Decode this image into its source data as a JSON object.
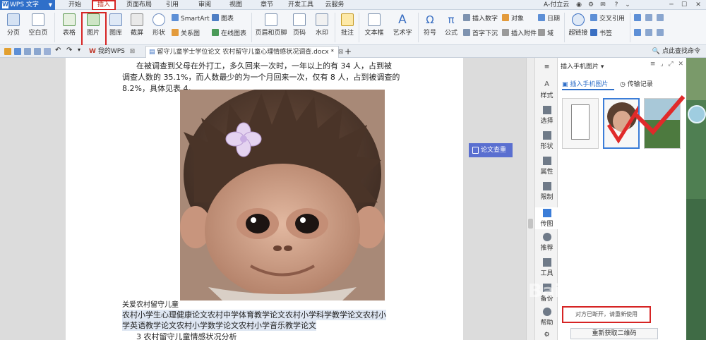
{
  "menubar": {
    "app_name": "WPS 文字",
    "tabs": [
      "开始",
      "插入",
      "页面布局",
      "引用",
      "审阅",
      "视图",
      "章节",
      "开发工具",
      "云服务"
    ],
    "user": "A-付立云"
  },
  "ribbon": {
    "page_break": "分页",
    "blank_page": "空白页",
    "table": "表格",
    "picture": "图片",
    "gallery": "图库",
    "screenshot": "截屏",
    "shapes": "形状",
    "smartart": "SmartArt",
    "chart": "图表",
    "relation": "关系图",
    "online_chart": "在线图表",
    "header_footer": "页眉和页脚",
    "page_number": "页码",
    "watermark": "水印",
    "comment": "批注",
    "textbox": "文本框",
    "wordart": "艺术字",
    "symbol": "符号",
    "formula": "公式",
    "insert_number": "插入数字",
    "object": "对象",
    "drop_cap": "首字下沉",
    "attachment": "插入附件",
    "date": "日期",
    "field": "域",
    "hyperlink": "超链接",
    "cross_ref": "交叉引用",
    "bookmark": "书签"
  },
  "doctabs": {
    "home": "我的WPS",
    "doc": "留守儿童学士学位论文 农村留守儿童心理情感状况调查.docx *",
    "add": "+",
    "help": "点此查找命令"
  },
  "document": {
    "line1": "在被调查到父母在外打工，多久回来一次时，一年以上的有 34 人，占到被",
    "line2": "调查人数的 35.1%，而人数最少的为一个月回来一次，仅有 8 人，占到被调查的",
    "line3": "8.2%，具体见表 4。",
    "caption": "关爱农村留守儿童",
    "link1": "农村小学生心理健康论文农村中学体育教学论文农村小学科学教学论文农村小",
    "link2": "学英语教学论文农村小学数学论文农村小学音乐教学论文",
    "heading": "3 农村留守儿童情感状况分析"
  },
  "float_button": "论文查重",
  "rail": [
    "样式",
    "选择",
    "形状",
    "属性",
    "限制",
    "传图",
    "推荐",
    "工具",
    "备份",
    "帮助"
  ],
  "panel": {
    "title": "插入手机图片",
    "tab_phone": "插入手机图片",
    "tab_history": "传输记录",
    "status": "对方已断开，请重新使用",
    "refresh": "重新获取二维码"
  },
  "watermark_text": "Baidu 经验"
}
